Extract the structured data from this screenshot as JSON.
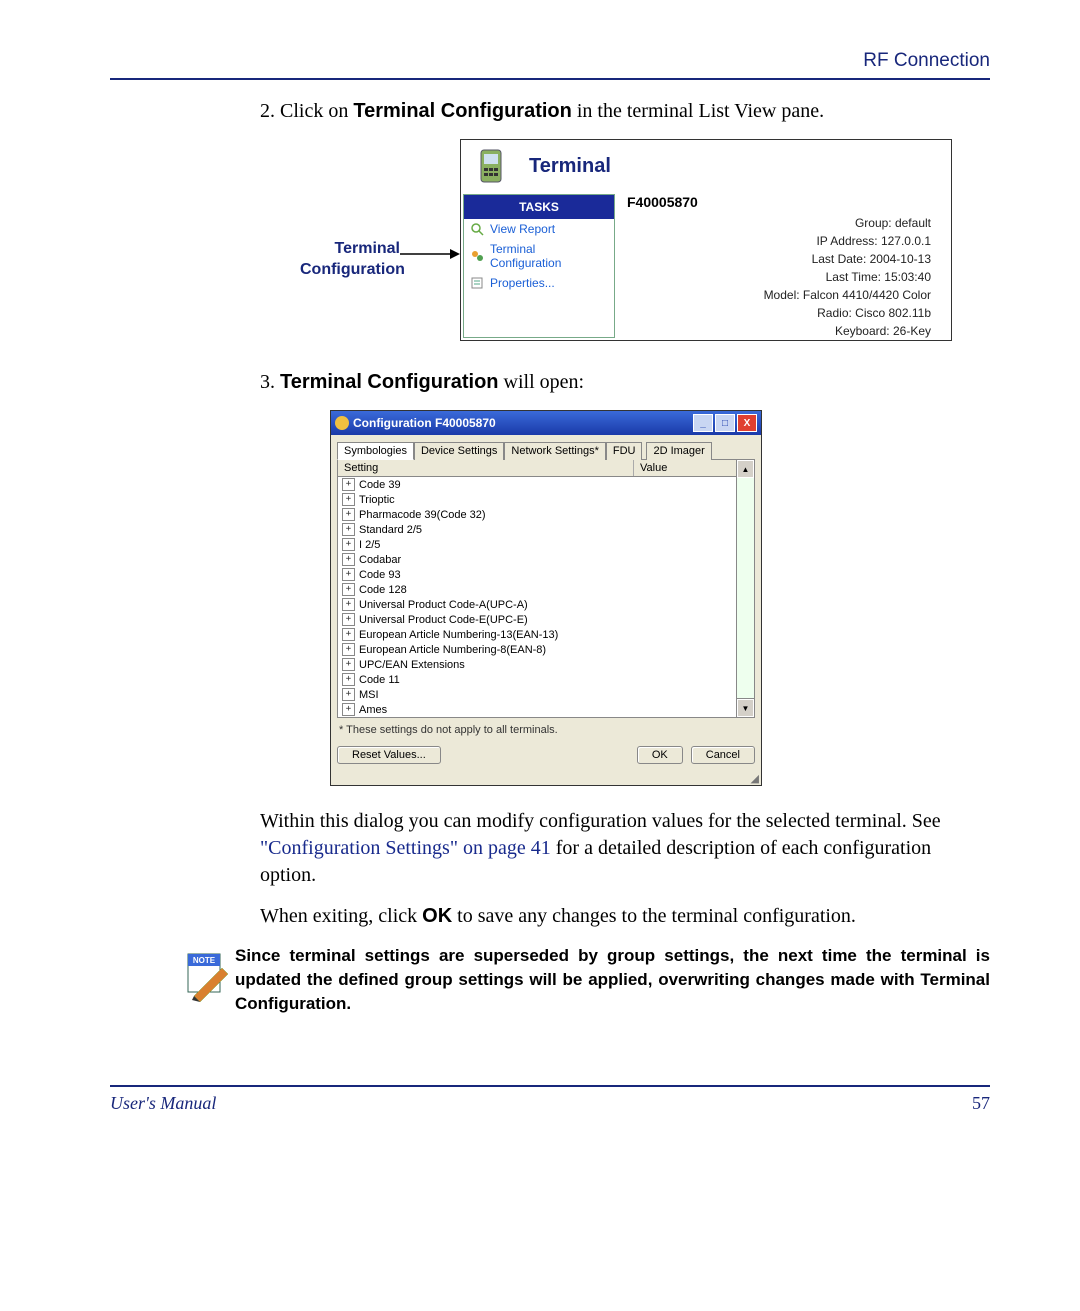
{
  "header": {
    "title": "RF Connection"
  },
  "step2": {
    "num": "2.",
    "pre": "Click on ",
    "bold": "Terminal Configuration",
    "post": " in the terminal List View pane."
  },
  "fig1": {
    "label_line1": "Terminal",
    "label_line2": "Configuration",
    "title": "Terminal",
    "tasks_head": "TASKS",
    "task_items": [
      "View Report",
      "Terminal Configuration",
      "Properties..."
    ],
    "terminal_id": "F40005870",
    "info": {
      "group": "Group: default",
      "ip": "IP Address: 127.0.0.1",
      "date": "Last Date: 2004-10-13",
      "time": "Last Time: 15:03:40",
      "model": "Model: Falcon 4410/4420 Color",
      "radio": "Radio: Cisco 802.11b",
      "keyboard": "Keyboard: 26-Key"
    }
  },
  "step3": {
    "num": "3.",
    "bold": "Terminal Configuration",
    "post": " will open:"
  },
  "dialog": {
    "title": "Configuration F40005870",
    "tabs": [
      "Symbologies",
      "Device Settings",
      "Network Settings*",
      "FDU",
      "2D Imager"
    ],
    "col_setting": "Setting",
    "col_value": "Value",
    "rows": [
      "Code 39",
      "Trioptic",
      "Pharmacode 39(Code 32)",
      "Standard 2/5",
      "I 2/5",
      "Codabar",
      "Code 93",
      "Code 128",
      "Universal Product Code-A(UPC-A)",
      "Universal Product Code-E(UPC-E)",
      "European Article Numbering-13(EAN-13)",
      "European Article Numbering-8(EAN-8)",
      "UPC/EAN Extensions",
      "Code 11",
      "MSI",
      "Ames"
    ],
    "footnote": "* These settings do not apply to all terminals.",
    "reset": "Reset Values...",
    "ok": "OK",
    "cancel": "Cancel"
  },
  "para1": {
    "pre": "Within this dialog you can modify configuration values for the selected terminal. See ",
    "link": "\"Configuration Settings\" on page 41",
    "post": " for a detailed description of each configuration option."
  },
  "para2": {
    "pre": "When exiting, click ",
    "bold": "OK",
    "post": " to save any changes to the terminal configuration."
  },
  "note": "Since terminal settings are superseded by group settings, the next time the terminal is updated the defined group settings will be applied, overwriting changes made with Terminal Configuration.",
  "footer": {
    "left": "User's Manual",
    "right": "57"
  }
}
